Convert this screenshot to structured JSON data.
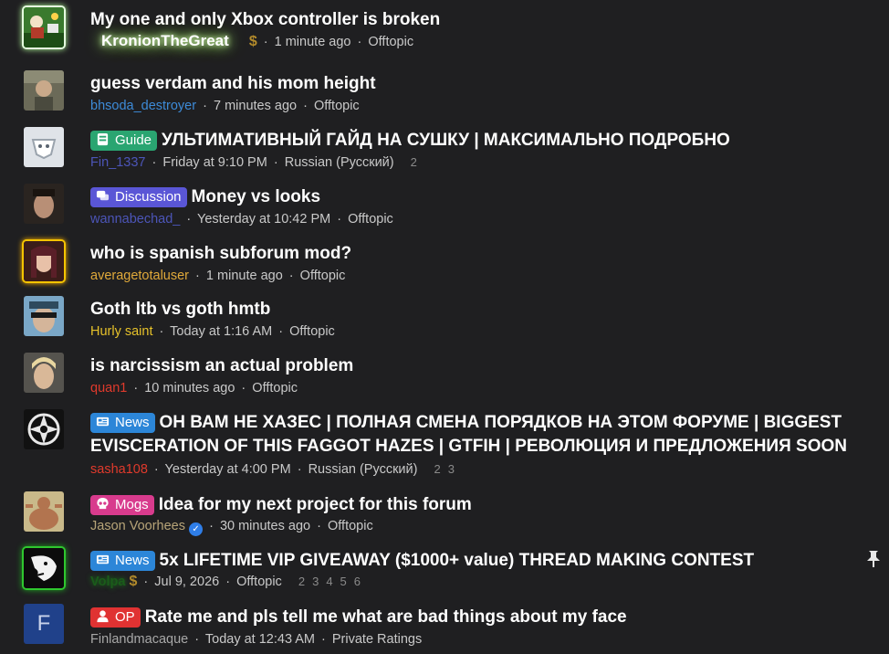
{
  "threads": [
    {
      "avatar_icon": "green-scene-avatar",
      "title": "My one and only Xbox controller is broken",
      "author": "KronionTheGreat",
      "author_badge": "$",
      "time": "1 minute ago",
      "forum": "Offtopic"
    },
    {
      "avatar_icon": "photo-avatar",
      "title": "guess verdam and his mom height",
      "author": "bhsoda_destroyer",
      "time": "7 minutes ago",
      "forum": "Offtopic"
    },
    {
      "avatar_icon": "vk-dog-avatar",
      "prefix": "Guide",
      "prefix_icon": "book-icon",
      "title": "УЛЬТИМАТИВНЫЙ ГАЙД НА СУШКУ | МАКСИМАЛЬНО ПОДРОБНО",
      "author": "Fin_1337",
      "time": "Friday at 9:10 PM",
      "forum": "Russian (Русский)",
      "pages": [
        "2"
      ]
    },
    {
      "avatar_icon": "face-avatar",
      "prefix": "Discussion",
      "prefix_icon": "chat-icon",
      "title": "Money vs looks",
      "author": "wannabechad_",
      "time": "Yesterday at 10:42 PM",
      "forum": "Offtopic"
    },
    {
      "avatar_icon": "anime-avatar",
      "title": "who is spanish subforum mod?",
      "author": "averagetotaluser",
      "time": "1 minute ago",
      "forum": "Offtopic"
    },
    {
      "avatar_icon": "sunglasses-avatar",
      "title": "Goth ltb vs goth hmtb",
      "author": "Hurly saint",
      "time": "Today at 1:16 AM",
      "forum": "Offtopic"
    },
    {
      "avatar_icon": "blond-avatar",
      "title": "is narcissism an actual problem",
      "author": "quan1",
      "time": "10 minutes ago",
      "forum": "Offtopic"
    },
    {
      "avatar_icon": "emblem-avatar",
      "prefix": "News",
      "prefix_icon": "newspaper-icon",
      "title": "ОН ВАМ НЕ ХАЗЕС | ПОЛНАЯ СМЕНА ПОРЯДКОВ НА ЭТОМ ФОРУМЕ | BIGGEST EVISCERATION OF THIS FAGGOT HAZES | GTFIH | РЕВОЛЮЦИЯ И ПРЕДЛОЖЕНИЯ SOON",
      "author": "sasha108",
      "time": "Yesterday at 4:00 PM",
      "forum": "Russian (Русский)",
      "pages": [
        "2",
        "3"
      ]
    },
    {
      "avatar_icon": "bodybuilder-avatar",
      "prefix": "Mogs",
      "prefix_icon": "skull-icon",
      "title": "Idea for my next project for this forum",
      "author": "Jason Voorhees",
      "verified": true,
      "time": "30 minutes ago",
      "forum": "Offtopic"
    },
    {
      "avatar_icon": "drawn-face-avatar",
      "prefix": "News",
      "prefix_icon": "newspaper-icon",
      "title": "5x LIFETIME VIP GIVEAWAY ($1000+ value) THREAD MAKING CONTEST",
      "author": "Volpa",
      "author_badge": "$",
      "time": "Jul 9, 2026",
      "forum": "Offtopic",
      "pages": [
        "2",
        "3",
        "4",
        "5",
        "6"
      ],
      "pinned": true
    },
    {
      "avatar_icon": "letter-avatar",
      "avatar_letter": "F",
      "prefix": "OP",
      "prefix_icon": "person-icon",
      "title": "Rate me and pls tell me what are bad things about my face",
      "author": "Finlandmacaque",
      "time": "Today at 12:43 AM",
      "forum": "Private Ratings"
    }
  ],
  "separator": "·",
  "colors": {
    "background": "#1f1f21",
    "guide": "#2aa571",
    "discussion": "#5a56d6",
    "news": "#2c86d8",
    "mogs": "#d83b8d",
    "op": "#e03232"
  }
}
